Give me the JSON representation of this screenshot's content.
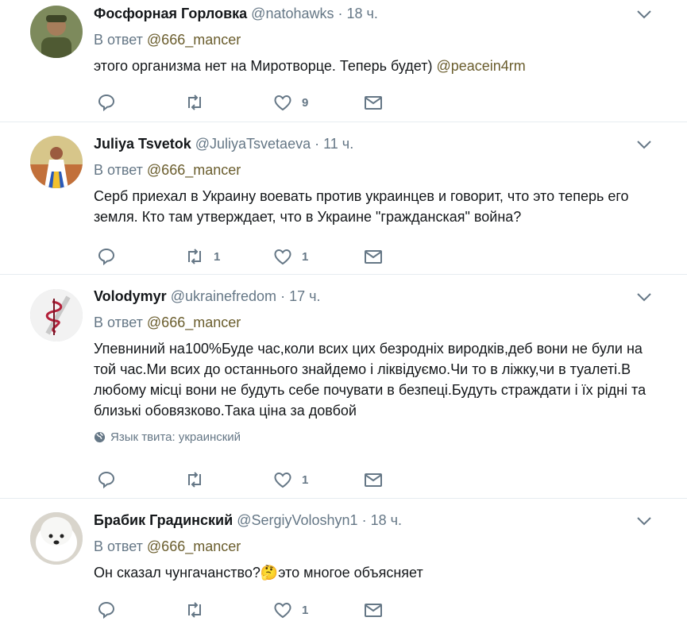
{
  "colors": {
    "text": "#14171a",
    "muted": "#657786",
    "link": "#6a5d2d",
    "divider": "#e6ecf0"
  },
  "reply_prefix": "В ответ",
  "tweets": [
    {
      "name": "Фосфорная Горловка",
      "handle": "@natohawks",
      "dot": "·",
      "time": "18 ч.",
      "reply_to": "@666_mancer",
      "text": "этого организма нет на Миротворце. Теперь будет) ",
      "link": "@peacein4rm",
      "lang": "",
      "replies": "",
      "retweets": "",
      "likes": "9"
    },
    {
      "name": "Juliya Tsvetok",
      "handle": "@JuliyaTsvetaeva",
      "dot": "·",
      "time": "11 ч.",
      "reply_to": "@666_mancer",
      "text": "Серб приехал в Украину воевать против украинцев и говорит, что это теперь его земля.  Кто там утверждает, что в Украине \"гражданская\" война?",
      "lang": "",
      "replies": "",
      "retweets": "1",
      "likes": "1"
    },
    {
      "name": "Volodymyr",
      "handle": "@ukrainefredom",
      "dot": "·",
      "time": "17 ч.",
      "reply_to": "@666_mancer",
      "text": "Упевниний на100%Буде час,коли всих цих безродніх виродків,деб вони не були на той час.Ми всих до останнього знайдемо і ліквідуємо.Чи то в ліжку,чи в туалеті.В любому місці вони не будуть себе почувати в безпеці.Будуть страждати і їх рідні та близькі обовязково.Така ціна за довбой",
      "lang": "Язык твита: украинский",
      "replies": "",
      "retweets": "",
      "likes": "1"
    },
    {
      "name": "Брабик Градинский",
      "handle": "@SergiyVoloshyn1",
      "dot": "·",
      "time": "18 ч.",
      "reply_to": "@666_mancer",
      "text": "Он сказал чунгачанство?",
      "emoji": "🤔",
      "text2": "это многое объясняет",
      "lang": "",
      "replies": "",
      "retweets": "",
      "likes": "1"
    }
  ]
}
